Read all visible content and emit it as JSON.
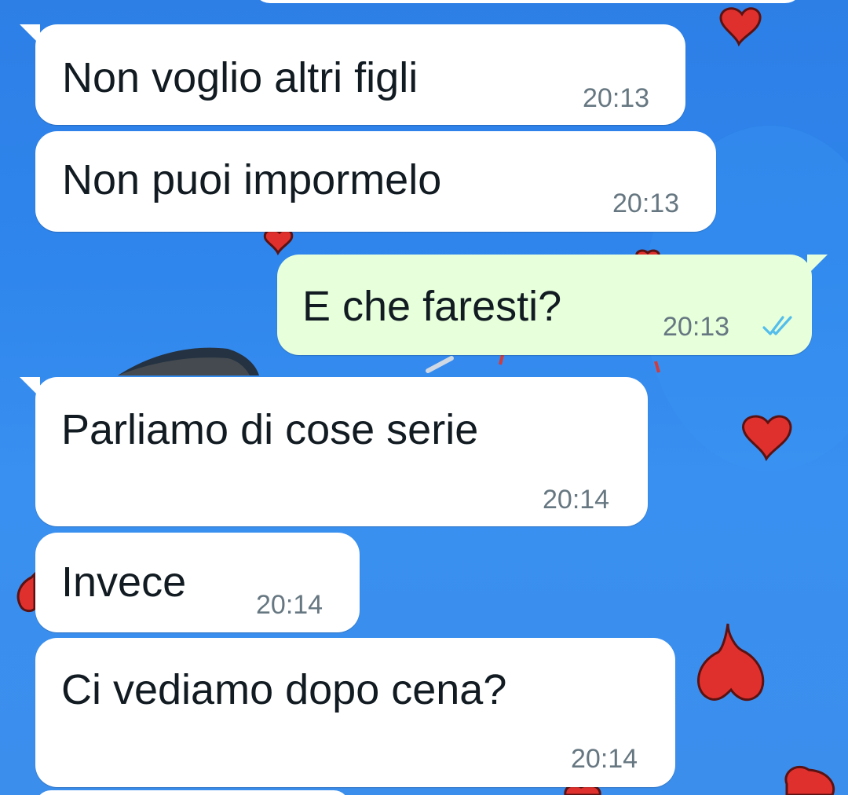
{
  "messages": [
    {
      "direction": "incoming",
      "text": "Non voglio altri figli",
      "time": "20:13"
    },
    {
      "direction": "incoming",
      "text": "Non puoi impormelo",
      "time": "20:13"
    },
    {
      "direction": "outgoing",
      "text": "E che faresti?",
      "time": "20:13",
      "status_icon": "double-check-read-icon"
    },
    {
      "direction": "incoming",
      "text": "Parliamo di cose serie",
      "time": "20:14"
    },
    {
      "direction": "incoming",
      "text": "Invece",
      "time": "20:14"
    },
    {
      "direction": "incoming",
      "text": "Ci vediamo dopo cena?",
      "time": "20:14"
    }
  ],
  "colors": {
    "wallpaper_sky": "#2f86ec",
    "incoming_bubble": "#ffffff",
    "outgoing_bubble": "#e7ffdb",
    "message_text": "#111b21",
    "timestamp": "#667781",
    "read_ticks": "#53bdeb",
    "heart": "#e0302d"
  }
}
